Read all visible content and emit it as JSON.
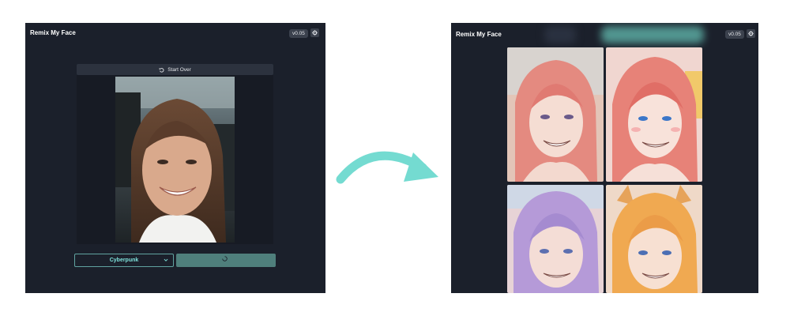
{
  "app": {
    "title": "Remix My Face",
    "version": "v0.05"
  },
  "left": {
    "start_over_label": "Start Over",
    "style_value": "Cyberpunk"
  },
  "colors": {
    "panel_bg": "#1b202b",
    "accent": "#7fe3dc",
    "arrow": "#74dbd1",
    "button": "#4f7f7c"
  },
  "icons": {
    "undo": "undo-icon",
    "settings": "gear-icon",
    "chevron": "chevron-down-icon",
    "spinner": "spinner-icon",
    "arrow": "curved-arrow-icon"
  }
}
